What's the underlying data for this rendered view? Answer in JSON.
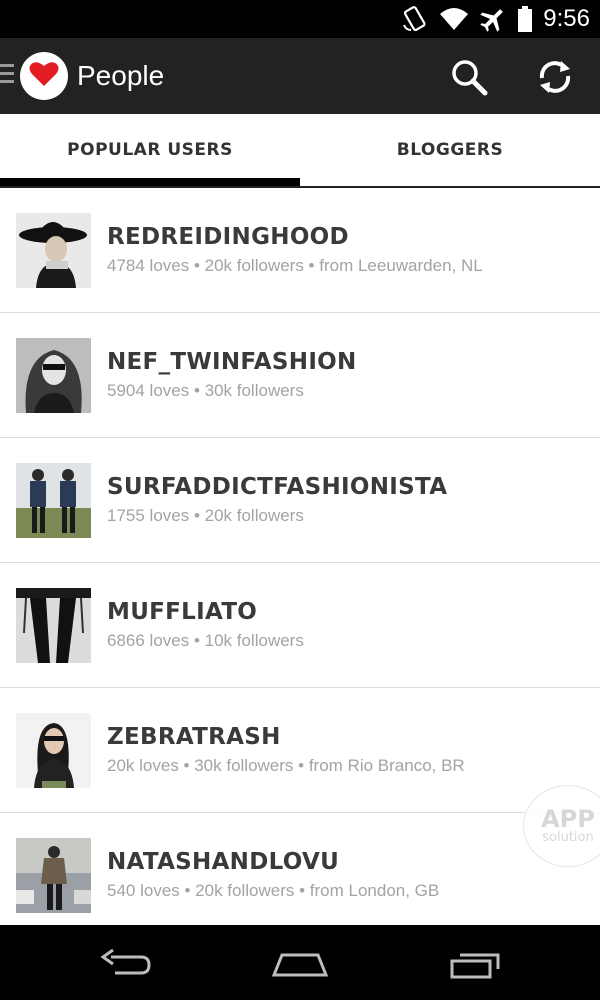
{
  "status_bar": {
    "time": "9:56",
    "icons": [
      "rotation-lock-icon",
      "wifi-icon",
      "airplane-icon",
      "battery-icon"
    ]
  },
  "app_bar": {
    "title": "People",
    "logo_icon": "heart-icon",
    "actions": [
      "search-icon",
      "refresh-icon"
    ]
  },
  "tabs": [
    {
      "label": "POPULAR USERS",
      "selected": true
    },
    {
      "label": "BLOGGERS",
      "selected": false
    }
  ],
  "users": [
    {
      "name": "REDREIDINGHOOD",
      "stats": "4784 loves • 20k followers • from Leeuwarden, NL"
    },
    {
      "name": "NEF_TWINFASHION",
      "stats": "5904 loves • 30k followers"
    },
    {
      "name": "SURFADDICTFASHIONISTA",
      "stats": "1755 loves • 20k followers"
    },
    {
      "name": "MUFFLIATO",
      "stats": "6866 loves • 10k followers"
    },
    {
      "name": "ZEBRATRASH",
      "stats": "20k loves • 30k followers • from Rio Branco, BR"
    },
    {
      "name": "NATASHANDLOVU",
      "stats": "540 loves • 20k followers • from London, GB"
    }
  ],
  "watermark": {
    "main": "APP",
    "sub": "solution"
  },
  "nav_bar": [
    "back-icon",
    "home-icon",
    "recents-icon"
  ],
  "colors": {
    "app_bar": "#222222",
    "accent": "#e31b23",
    "tab_indicator": "#000000",
    "secondary_text": "#a3a3a3"
  }
}
